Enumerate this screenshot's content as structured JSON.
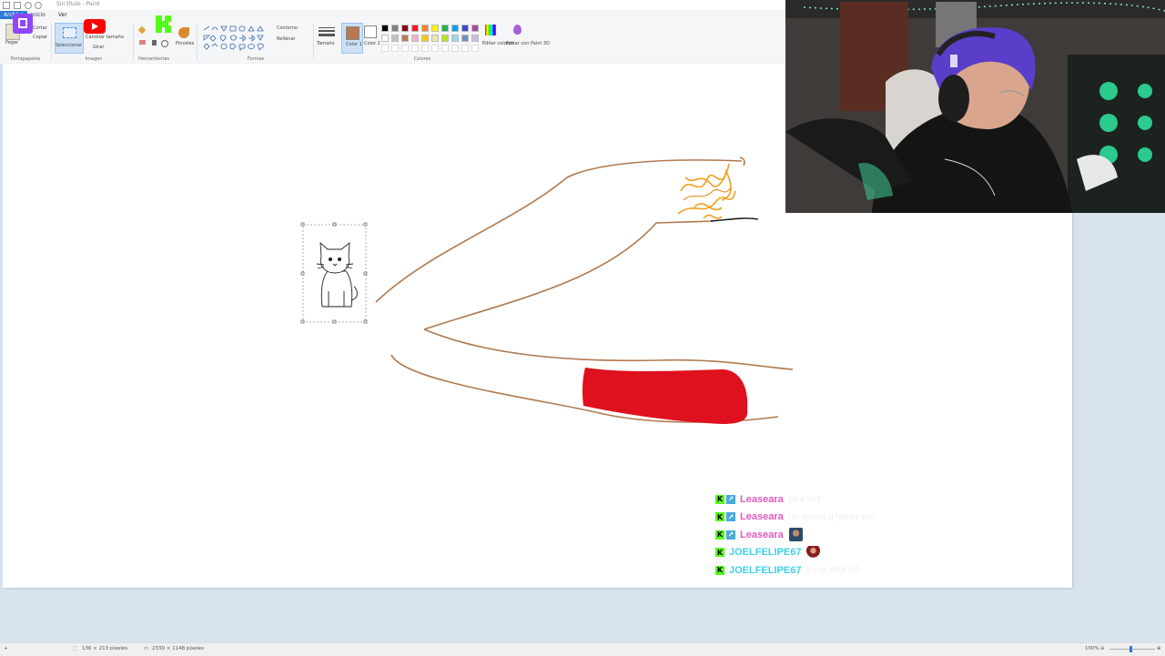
{
  "window": {
    "title": "Sin título - Paint"
  },
  "menu": {
    "tabs": [
      "Archivo",
      "Inicio",
      "Ver"
    ]
  },
  "ribbon": {
    "clipboard": {
      "paste_label": "Pegar",
      "cut_label": "Cortar",
      "copy_label": "Copiar",
      "group_label": "Portapapeles"
    },
    "image": {
      "select_label": "Seleccionar",
      "resize_label": "Cambiar tamaño",
      "rotate_label": "Girar",
      "group_label": "Imagen"
    },
    "tools": {
      "brushes_label": "Pinceles",
      "group_label": "Herramientas"
    },
    "shapes": {
      "outline_label": "Contorno",
      "fill_label": "Rellenar",
      "group_label": "Formas"
    },
    "colors": {
      "size_label": "Tamaño",
      "color1_label": "Color 1",
      "color2_label": "Color 2",
      "edit_colors_label": "Editar colores",
      "edit_3d_label": "Editar con Paint 3D",
      "group_label": "Colores",
      "color1": "#b87852",
      "color2": "#ffffff",
      "palette": [
        "#000000",
        "#7f7f7f",
        "#880015",
        "#ed1c24",
        "#ff7f27",
        "#fff200",
        "#22b14c",
        "#00a2e8",
        "#3f48cc",
        "#a349a4",
        "#ffffff",
        "#c3c3c3",
        "#b97a57",
        "#ffaec9",
        "#ffc90e",
        "#efe4b0",
        "#b5e61d",
        "#99d9ea",
        "#7092be",
        "#c8bfe7"
      ]
    }
  },
  "overlay": {
    "stream_logos": [
      "twitch-logo",
      "youtube-logo",
      "kick-logo"
    ]
  },
  "statusbar": {
    "selection_size": "136 × 213 píxeles",
    "image_size": "2330 × 1148 píxeles",
    "zoom": "100%"
  },
  "chat": {
    "messages": [
      {
        "user": "Leaseara",
        "user_color": "#e05bbf",
        "badges": [
          "kick",
          "prime"
        ],
        "text": "otra vez"
      },
      {
        "user": "Leaseara",
        "user_color": "#e05bbf",
        "badges": [
          "kick",
          "prime"
        ],
        "text": "no tienes q hacer eso"
      },
      {
        "user": "Leaseara",
        "user_color": "#e05bbf",
        "badges": [
          "kick",
          "prime"
        ],
        "text": "",
        "emote": "avatar-emote"
      },
      {
        "user": "JOELFELIPE67",
        "user_color": "#3fd0e8",
        "badges": [
          "kick"
        ],
        "text": "",
        "emote": "person-emote"
      },
      {
        "user": "JOELFELIPE67",
        "user_color": "#3fd0e8",
        "badges": [
          "kick"
        ],
        "text": "yo sí voté xD"
      }
    ]
  },
  "colors": {
    "drawing_brown": "#b07a50",
    "drawing_red": "#e0111e",
    "flame_orange": "#f0a020",
    "accent_blue": "#2b78d6"
  }
}
